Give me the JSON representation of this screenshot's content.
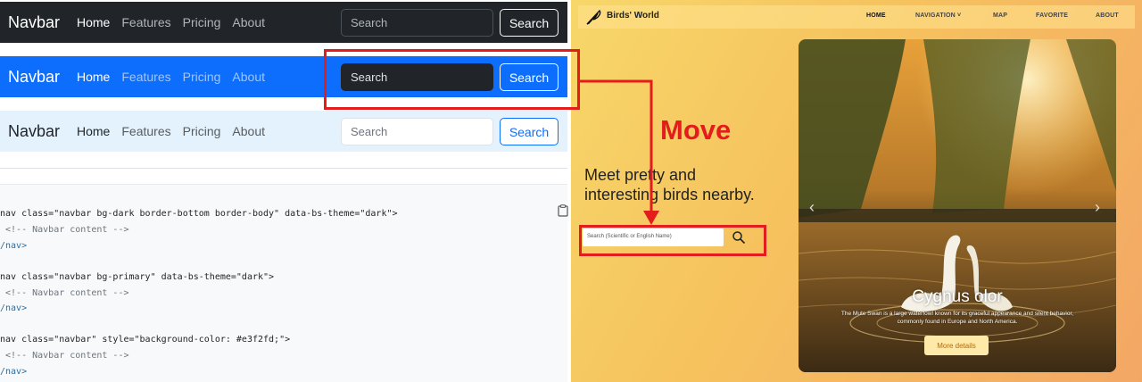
{
  "left": {
    "navbars": [
      {
        "brand": "Navbar",
        "links": [
          "Home",
          "Features",
          "Pricing",
          "About"
        ],
        "search_placeholder": "Search",
        "search_button": "Search"
      },
      {
        "brand": "Navbar",
        "links": [
          "Home",
          "Features",
          "Pricing",
          "About"
        ],
        "search_placeholder": "Search",
        "search_button": "Search"
      },
      {
        "brand": "Navbar",
        "links": [
          "Home",
          "Features",
          "Pricing",
          "About"
        ],
        "search_placeholder": "Search",
        "search_button": "Search"
      }
    ],
    "code_lines": [
      "nav class=\"navbar bg-dark border-bottom border-body\" data-bs-theme=\"dark\">",
      " <!-- Navbar content -->",
      "/nav>",
      "nav class=\"navbar bg-primary\" data-bs-theme=\"dark\">",
      " <!-- Navbar content -->",
      "/nav>",
      "nav class=\"navbar\" style=\"background-color: #e3f2fd;\">",
      " <!-- Navbar content -->",
      "/nav>"
    ]
  },
  "annotation": {
    "move_label": "Move",
    "color": "#e31c1c"
  },
  "right": {
    "brand": "Birds' World",
    "nav": [
      "HOME",
      "NAVIGATION ˅",
      "MAP",
      "FAVORITE",
      "ABOUT"
    ],
    "hero_text": "Meet pretty and interesting birds nearby.",
    "search_placeholder": "Search (Scientific or English Name)",
    "carousel": {
      "title": "Cygnus olor",
      "description": "The Mute Swan is a large waterfowl known for its graceful appearance and silent behavior, commonly found in Europe and North America.",
      "button": "More details"
    }
  },
  "colors": {
    "dark": "#212529",
    "primary": "#0d6efd",
    "light_blue": "#e3f2fd"
  }
}
